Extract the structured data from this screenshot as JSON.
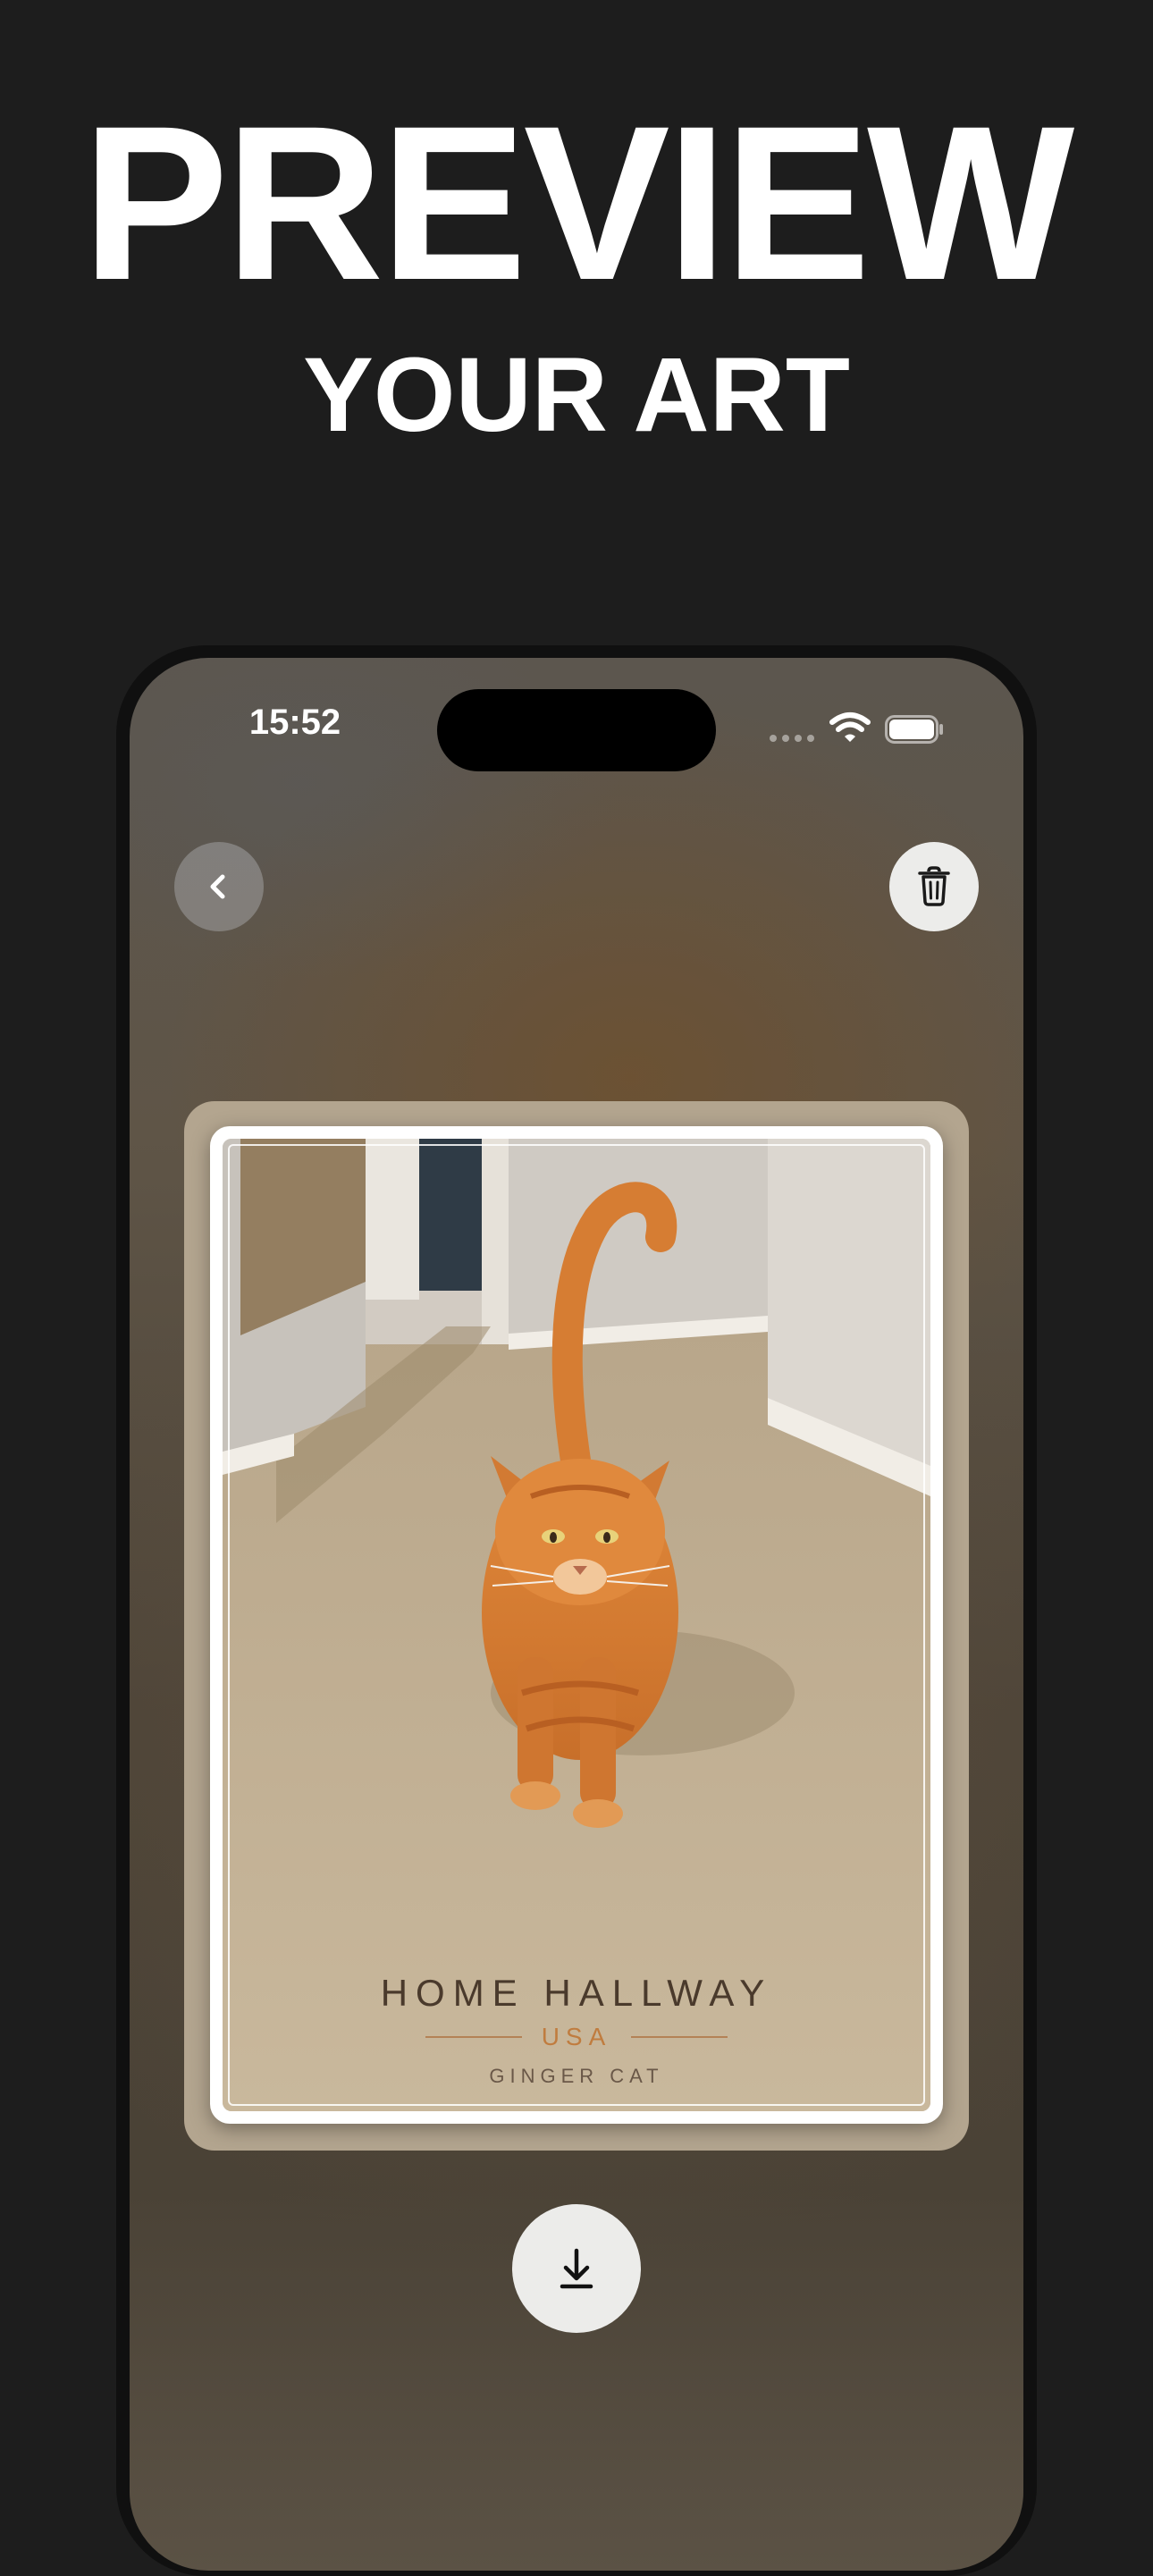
{
  "promo": {
    "headline": "PREVIEW",
    "subheadline": "YOUR ART"
  },
  "status_bar": {
    "time": "15:52",
    "wifi_icon": "wifi-icon",
    "battery_icon": "battery-icon"
  },
  "toolbar": {
    "back_icon": "chevron-left-icon",
    "trash_icon": "trash-icon"
  },
  "artwork": {
    "title": "HOME HALLWAY",
    "subtitle": "USA",
    "caption": "GINGER CAT"
  },
  "actions": {
    "download_icon": "download-icon"
  },
  "colors": {
    "page_background": "#1d1d1d",
    "screen_background": "#4e463a",
    "button_light": "#ececea",
    "art_title": "#4a3a2c",
    "art_accent": "#c07c3f"
  }
}
